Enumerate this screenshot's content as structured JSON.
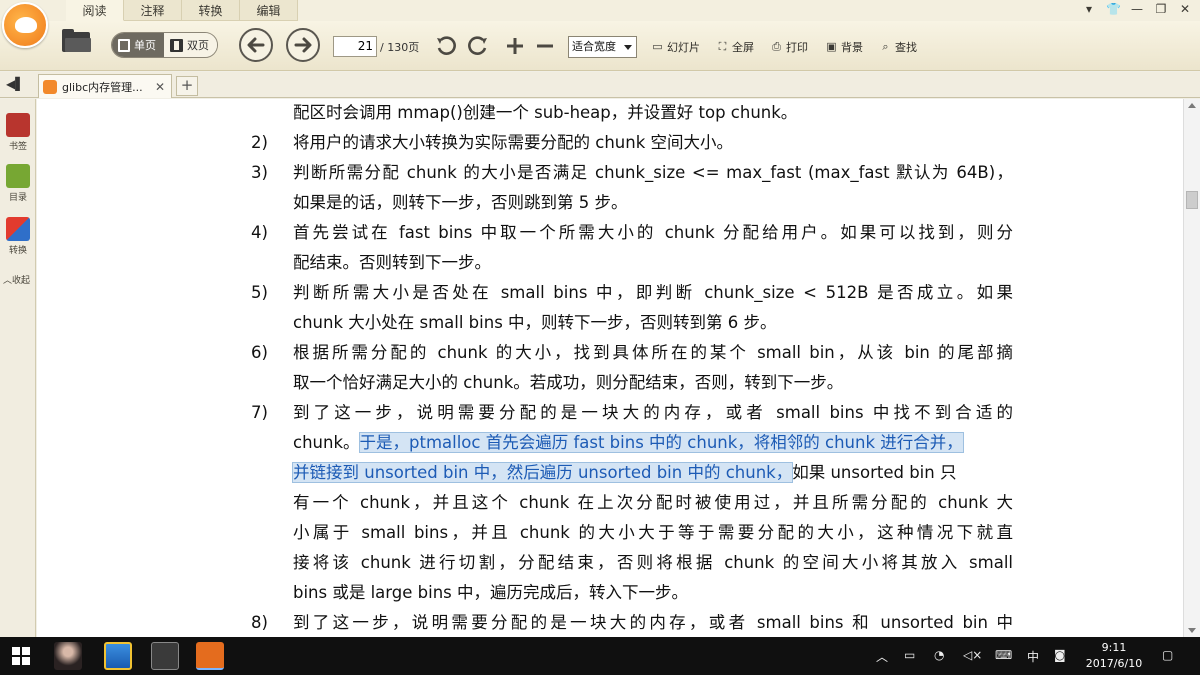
{
  "menu": {
    "tabs": [
      {
        "label": "阅读",
        "active": true
      },
      {
        "label": "注释",
        "active": false
      },
      {
        "label": "转换",
        "active": false
      },
      {
        "label": "编辑",
        "active": false
      }
    ]
  },
  "window_controls": {
    "pin": "▾",
    "skin": "👕",
    "minimize": "—",
    "restore": "❐",
    "close": "✕"
  },
  "toolbar": {
    "single_page_label": "单页",
    "double_page_label": "双页",
    "current_page": "21",
    "total_pages": "/ 130页",
    "zoom_value": "适合宽度",
    "slideshow_label": "幻灯片",
    "fullscreen_label": "全屏",
    "print_label": "打印",
    "background_label": "背景",
    "find_label": "查找"
  },
  "doc_tabs": {
    "active_tab_title": "glibc内存管理...",
    "close_symbol": "✕",
    "add_symbol": "+"
  },
  "sidebar": {
    "bookmark_label": "书签",
    "toc_label": "目录",
    "convert_label": "转换",
    "collapse_label": "收起"
  },
  "document": {
    "lines": [
      {
        "num": "",
        "text": "配区时会调用 mmap()创建一个 sub-heap，并设置好 top chunk。"
      },
      {
        "num": "2)",
        "text": "将用户的请求大小转换为实际需要分配的 chunk 空间大小。"
      },
      {
        "num": "3)",
        "text": "判断所需分配 chunk 的大小是否满足 chunk_size <= max_fast (max_fast  默认为  64B)，"
      },
      {
        "num": "",
        "text": "如果是的话，则转下一步，否则跳到第 5 步。"
      },
      {
        "num": "4)",
        "text": "首先尝试在 fast bins 中取一个所需大小的 chunk 分配给用户。如果可以找到，则分"
      },
      {
        "num": "",
        "text": "配结束。否则转到下一步。"
      },
      {
        "num": "5)",
        "text": "判断所需大小是否处在 small  bins 中，即判断 chunk_size  <  512B 是否成立。如果"
      },
      {
        "num": "",
        "text": "chunk 大小处在 small bins 中，则转下一步，否则转到第 6 步。"
      },
      {
        "num": "6)",
        "text": "根据所需分配的 chunk 的大小，找到具体所在的某个 small bin，从该 bin 的尾部摘"
      },
      {
        "num": "",
        "text": "取一个恰好满足大小的 chunk。若成功，则分配结束，否则，转到下一步。"
      },
      {
        "num": "7)",
        "text": "到了这一步，说明需要分配的是一块大的内存，或者  small  bins  中找不到合适的"
      },
      {
        "num": "",
        "text_before": "chunk。",
        "text_hl": "于是，ptmalloc 首先会遍历 fast bins 中的 chunk，将相邻的 chunk 进行合并，",
        "text_after": ""
      },
      {
        "num": "",
        "text_before": "",
        "text_hl": "并链接到 unsorted bin 中，然后遍历 unsorted bin 中的 chunk，",
        "text_after": "如果 unsorted bin 只"
      },
      {
        "num": "",
        "text": "有一个 chunk，并且这个 chunk 在上次分配时被使用过，并且所需分配的 chunk 大"
      },
      {
        "num": "",
        "text": "小属于 small  bins，并且 chunk 的大小大于等于需要分配的大小，这种情况下就直"
      },
      {
        "num": "",
        "text": "接将该 chunk 进行切割，分配结束，否则将根据 chunk 的空间大小将其放入 small"
      },
      {
        "num": "",
        "text": "bins 或是 large bins 中，遍历完成后，转入下一步。"
      },
      {
        "num": "8)",
        "text": "到了这一步，说明需要分配的是一块大的内存，或者 small bins 和 unsorted bin 中"
      }
    ]
  },
  "taskbar": {
    "time": "9:11",
    "date": "2017/6/10",
    "ime": "中"
  }
}
